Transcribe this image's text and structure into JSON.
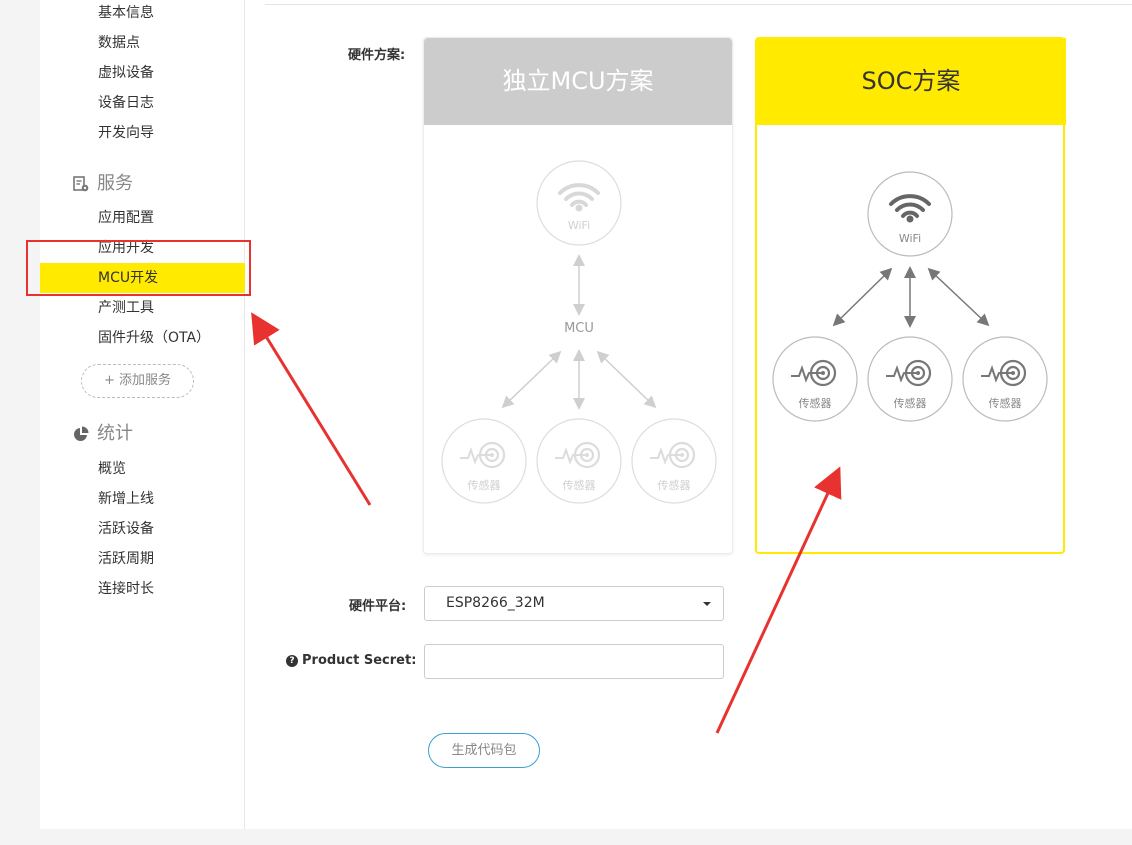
{
  "sidebar": {
    "device_items": [
      "基本信息",
      "数据点",
      "虚拟设备",
      "设备日志",
      "开发向导"
    ],
    "services_title": "服务",
    "service_items": [
      "应用配置",
      "应用开发",
      "MCU开发",
      "产测工具",
      "固件升级（OTA）"
    ],
    "active_item": "MCU开发",
    "add_service_label": "+ 添加服务",
    "stats_title": "统计",
    "stats_items": [
      "概览",
      "新增上线",
      "活跃设备",
      "活跃周期",
      "连接时长"
    ]
  },
  "form": {
    "hardware_scheme_label": "硬件方案:",
    "hardware_platform_label": "硬件平台:",
    "hardware_platform_value": "ESP8266_32M",
    "product_secret_label": "Product Secret:",
    "product_secret_value": "",
    "generate_button": "生成代码包"
  },
  "cards": {
    "mcu": {
      "title": "独立MCU方案",
      "wifi_label": "WiFi",
      "mcu_label": "MCU",
      "sensor_label": "传感器",
      "header_color": "#cccccc",
      "selected": false
    },
    "soc": {
      "title": "SOC方案",
      "wifi_label": "WiFi",
      "sensor_label": "传感器",
      "header_color": "#ffea00",
      "selected": true
    }
  },
  "colors": {
    "accent_yellow": "#ffea00",
    "annotation_red": "#e8322f",
    "button_border": "#3aa0d0"
  }
}
